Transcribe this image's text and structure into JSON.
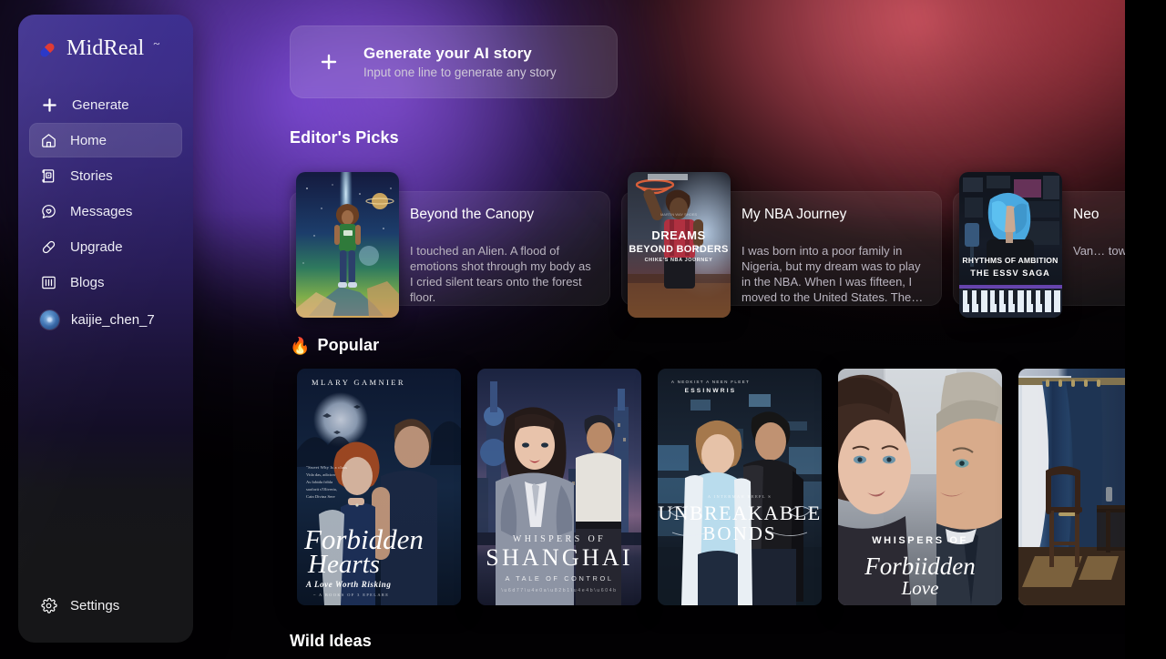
{
  "app": {
    "brand_name": "MidReal",
    "brand_tilde": "~"
  },
  "sidebar": {
    "items": [
      {
        "label": "Generate",
        "icon": "plus-icon",
        "active": false
      },
      {
        "label": "Home",
        "icon": "home-icon",
        "active": true
      },
      {
        "label": "Stories",
        "icon": "stories-icon",
        "active": false
      },
      {
        "label": "Messages",
        "icon": "message-heart-icon",
        "active": false
      },
      {
        "label": "Upgrade",
        "icon": "pill-icon",
        "active": false
      },
      {
        "label": "Blogs",
        "icon": "blogs-icon",
        "active": false
      }
    ],
    "user": {
      "name": "kaijie_chen_7",
      "icon": "avatar"
    },
    "settings": {
      "label": "Settings",
      "icon": "gear-icon"
    }
  },
  "banner": {
    "title": "Generate your AI story",
    "subtitle": "Input one line to generate any story",
    "icon": "plus-icon"
  },
  "sections": {
    "editors_picks": {
      "title": "Editor's Picks"
    },
    "popular": {
      "title": "Popular",
      "emoji": "🔥"
    },
    "wild_ideas": {
      "title": "Wild Ideas"
    }
  },
  "editors_picks": [
    {
      "title": "Beyond the Canopy",
      "description": "I touched an Alien. A flood of emotions shot through my body as I cried silent tears onto the forest floor.",
      "cover_style": "space-girl-green-shirt"
    },
    {
      "title": "My NBA Journey",
      "description": "I was born into a poor family in Nigeria, but my dream was to play in the NBA. When I was fifteen, I moved to the United States. The…",
      "cover_style": "basketball-dunk",
      "cover_text": [
        "DREAMS",
        "BEYOND BORDERS",
        "CHIKE'S NBA JOURNEY"
      ]
    },
    {
      "title": "Neo",
      "description": "Van… tow… sens… chal…",
      "cover_style": "blue-hair-synth",
      "cover_text": [
        "RHYTHMS OF AMBITION",
        "THE ESSV SAGA"
      ]
    }
  ],
  "popular": [
    {
      "title": "Forbidden Hearts",
      "cover_text": {
        "author": "MLARY GAMNIER",
        "title_line1": "Forbidden",
        "title_line2": "Hearts",
        "subtitle": "A Love Worth Risking"
      },
      "cover_style": "moonlit-couple-blue"
    },
    {
      "title": "Whispers of Shanghai",
      "cover_text": {
        "kicker": "WHISPERS OF",
        "title_line1": "SHANGHAI",
        "subtitle": "A TALE OF CONTROL"
      },
      "cover_style": "shanghai-skyline-suit"
    },
    {
      "title": "Unbreakable Bonds",
      "cover_text": {
        "author": "ESSINWRIS",
        "title_line1": "UNBREAKABLE",
        "title_line2": "BONDS"
      },
      "cover_style": "lab-couple-blue"
    },
    {
      "title": "Whispers of Forbiidden Love",
      "cover_text": {
        "kicker": "WHISPERS OF",
        "title_line1": "Forbiidden",
        "title_line2": "Love"
      },
      "cover_style": "closeup-faces"
    },
    {
      "title": "",
      "cover_text": {},
      "cover_style": "blue-curtain-room"
    }
  ],
  "colors": {
    "brand_red": "#e03b34",
    "brand_blue": "#2b39c9",
    "accent_purple": "#6a4ad0",
    "glow_red": "#e2606e",
    "sidebar_top": "#3a2c8e",
    "sidebar_bottom": "#161618",
    "text_primary": "#ffffff",
    "text_muted": "#b9b4bf"
  }
}
